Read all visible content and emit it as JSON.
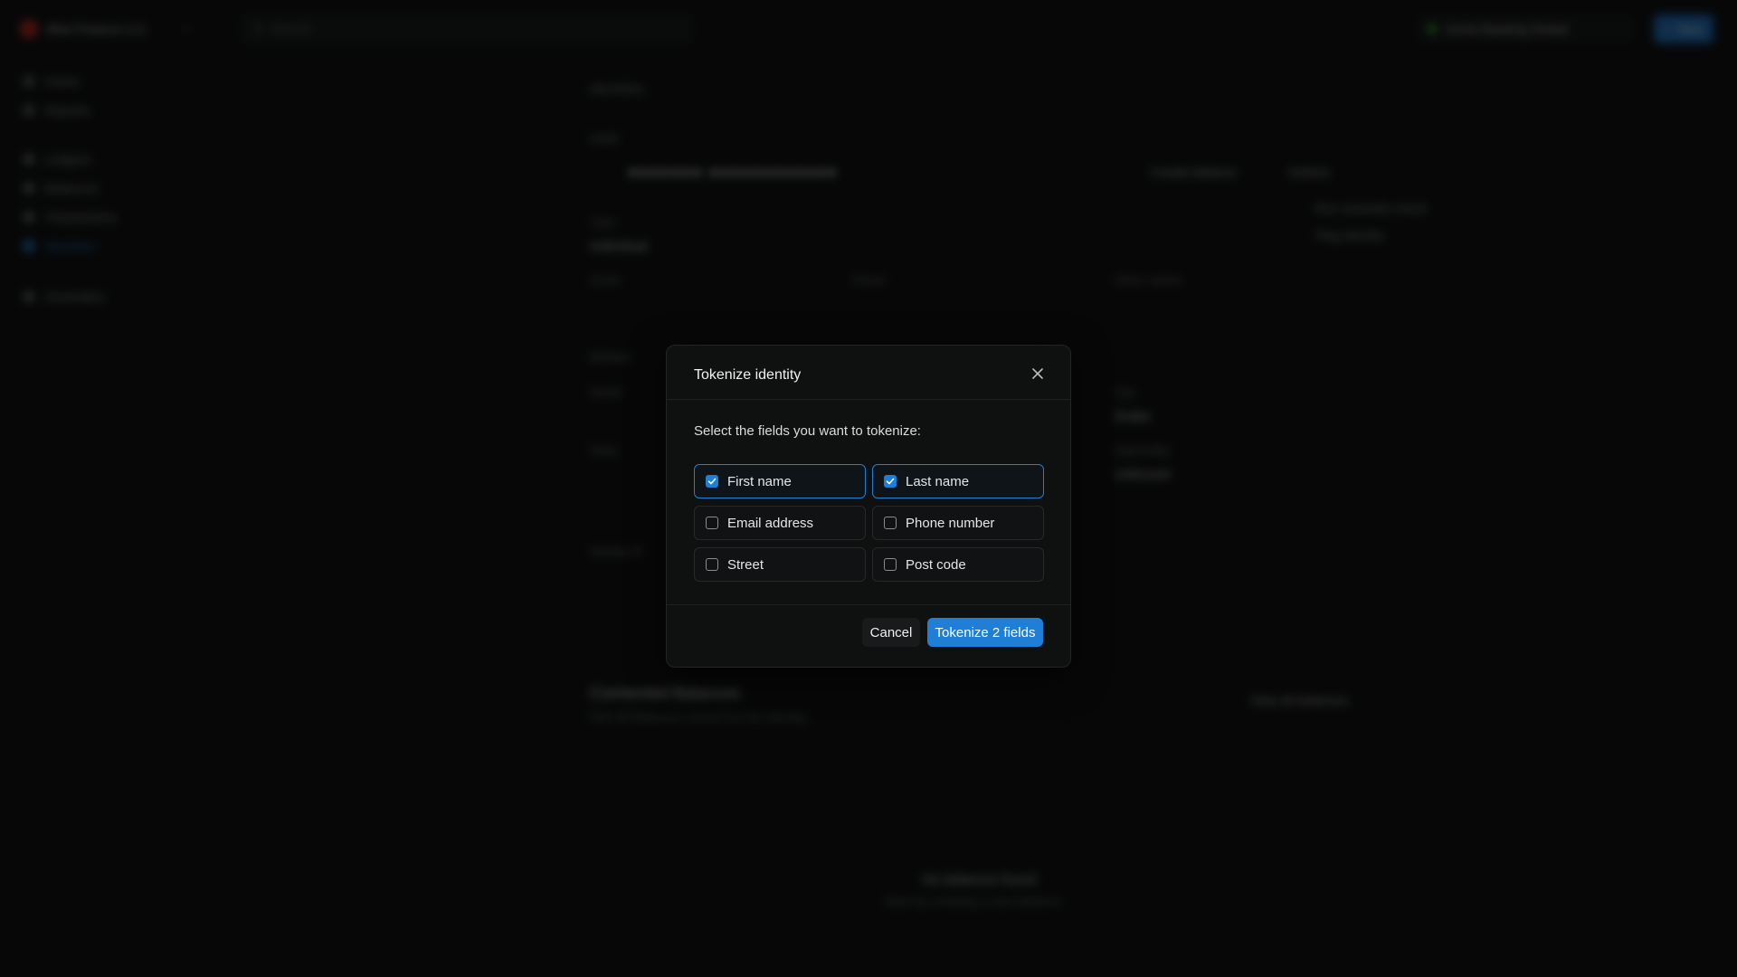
{
  "topbar": {
    "org_name": "Blnk Finance LLC",
    "search_placeholder": "Search",
    "environment": "Acme Banking Global",
    "new_label": "New"
  },
  "sidebar": {
    "items": [
      {
        "label": "Home"
      },
      {
        "label": "Reports"
      },
      {
        "label": "Ledgers"
      },
      {
        "label": "Balances"
      },
      {
        "label": "Transactions"
      },
      {
        "label": "Identities"
      },
      {
        "label": "Anomalies"
      }
    ],
    "active": "Identities"
  },
  "background": {
    "breadcrumb": "Identities",
    "section_name": "NAME",
    "masked_name": "●●●●●●●  ●●●●●●●●●●●●",
    "create_balance": "Create balance",
    "actions": "Actions",
    "menu_run_anomaly": "Run anomaly check",
    "menu_flag_identity": "Flag identity",
    "type_label": "Type",
    "type_value": "Individual",
    "email_label": "Email",
    "phone_label": "Phone",
    "other_names_label": "Other names",
    "details_label": "DETAILS",
    "street_label": "Street",
    "city_label": "City",
    "city_value": "Drake",
    "state_label": "State",
    "nationality_label": "Nationality",
    "nationality_value": "Unknown",
    "identity_id_label": "Identity ID",
    "connected_title": "Connected Balances",
    "connected_sub": "See all balances owned by this identity",
    "view_all": "View all balances",
    "empty_title": "No balances found",
    "empty_sub": "Start by creating a new balance"
  },
  "modal": {
    "title": "Tokenize identity",
    "prompt": "Select the fields you want to tokenize:",
    "fields": [
      {
        "label": "First name",
        "checked": true
      },
      {
        "label": "Last name",
        "checked": true
      },
      {
        "label": "Email address",
        "checked": false
      },
      {
        "label": "Phone number",
        "checked": false
      },
      {
        "label": "Street",
        "checked": false
      },
      {
        "label": "Post code",
        "checked": false
      }
    ],
    "cancel_label": "Cancel",
    "submit_label": "Tokenize 2 fields"
  },
  "colors": {
    "accent": "#1f7fd6",
    "background": "#0b0c0c"
  }
}
